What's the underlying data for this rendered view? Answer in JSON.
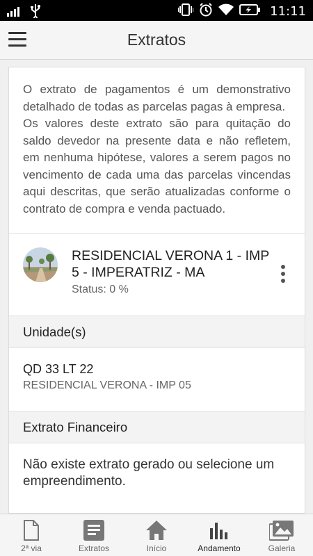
{
  "status_bar": {
    "time": "11:11"
  },
  "app_bar": {
    "title": "Extratos"
  },
  "intro_text": "O extrato de pagamentos é um demonstrativo detalhado de todas as parcelas pagas à empresa.\nOs valores deste extrato são para quitação do saldo devedor na presente data e não refletem, em nenhuma hipótese, valores a serem pagos no vencimento de cada uma das parcelas vincendas aqui descritas, que serão atualizadas conforme o contrato de compra e venda pactuado.",
  "project": {
    "name": "RESIDENCIAL VERONA 1 - IMP 5 - IMPERATRIZ - MA",
    "status": "Status: 0 %"
  },
  "units_section": {
    "title": "Unidade(s)"
  },
  "unit": {
    "code": "QD 33 LT 22",
    "development": "RESIDENCIAL VERONA - IMP 05"
  },
  "financial_section": {
    "title": "Extrato Financeiro",
    "empty_message": "Não existe extrato gerado ou selecione um empreendimento."
  },
  "bottom_nav": {
    "items": [
      {
        "label": "2ª via",
        "icon": "document-icon"
      },
      {
        "label": "Extratos",
        "icon": "list-icon"
      },
      {
        "label": "Início",
        "icon": "home-icon"
      },
      {
        "label": "Andamento",
        "icon": "bar-chart-icon"
      },
      {
        "label": "Galeria",
        "icon": "gallery-icon"
      }
    ],
    "active": "Andamento"
  },
  "colors": {
    "status_bar": "#000000",
    "app_bar": "#f5f5f5",
    "text_primary": "#222222",
    "text_secondary": "#666666"
  }
}
